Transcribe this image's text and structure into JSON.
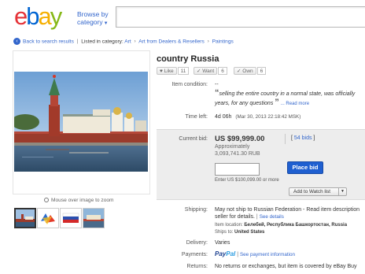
{
  "header": {
    "logo": [
      "e",
      "b",
      "a",
      "y"
    ],
    "logo_colors": [
      "#e53238",
      "#0064d2",
      "#f5af02",
      "#86b817"
    ],
    "browse_line1": "Browse by",
    "browse_line2": "category"
  },
  "breadcrumb": {
    "back": "Back to search results",
    "listed_in": "Listed in category:",
    "items": [
      "Art",
      "Art from Dealers & Resellers",
      "Paintings"
    ]
  },
  "gallery": {
    "zoom_hint": "Mouse over image to zoom",
    "thumbnail_count": 4
  },
  "item": {
    "title": "country Russia",
    "like": {
      "label": "Like",
      "count": "11"
    },
    "want": {
      "label": "Want",
      "count": "6"
    },
    "own": {
      "label": "Own",
      "count": "6"
    },
    "condition_label": "Item condition:",
    "condition_value": "--",
    "quote_line1": "selling the entire country in a normal state, was officially",
    "quote_line2": "years, for any questions",
    "read_more": "Read more",
    "time_left_label": "Time left:",
    "time_left_value": "4d 06h",
    "time_left_end": "(Mar 30, 2013  22:18:42 MSK)"
  },
  "bid": {
    "current_bid_label": "Current bid:",
    "price": "US $99,999.00",
    "approx_label": "Approximately",
    "approx_value": "3,093,741.30 RUB",
    "bids_link": "54 bids",
    "bid_input_value": "",
    "place_bid": "Place bid",
    "enter_note": "Enter US $100,099.00 or more",
    "watch_list": "Add to Watch list"
  },
  "shipping": {
    "label": "Shipping:",
    "line1": "May not ship to Russian Federation - Read item description",
    "line2": "seller for details.",
    "see_details": "See details",
    "location_label": "Item location:",
    "location_value": "Белебей, Республика Башкортостан, Russia",
    "ships_to_label": "Ships to:",
    "ships_to_value": "United States"
  },
  "delivery": {
    "label": "Delivery:",
    "value": "Varies"
  },
  "payments": {
    "label": "Payments:",
    "paypal_a": "Pay",
    "paypal_b": "Pal",
    "details": "See payment information"
  },
  "returns": {
    "label": "Returns:",
    "value": "No returns or exchanges, but item is covered by eBay Buy"
  }
}
